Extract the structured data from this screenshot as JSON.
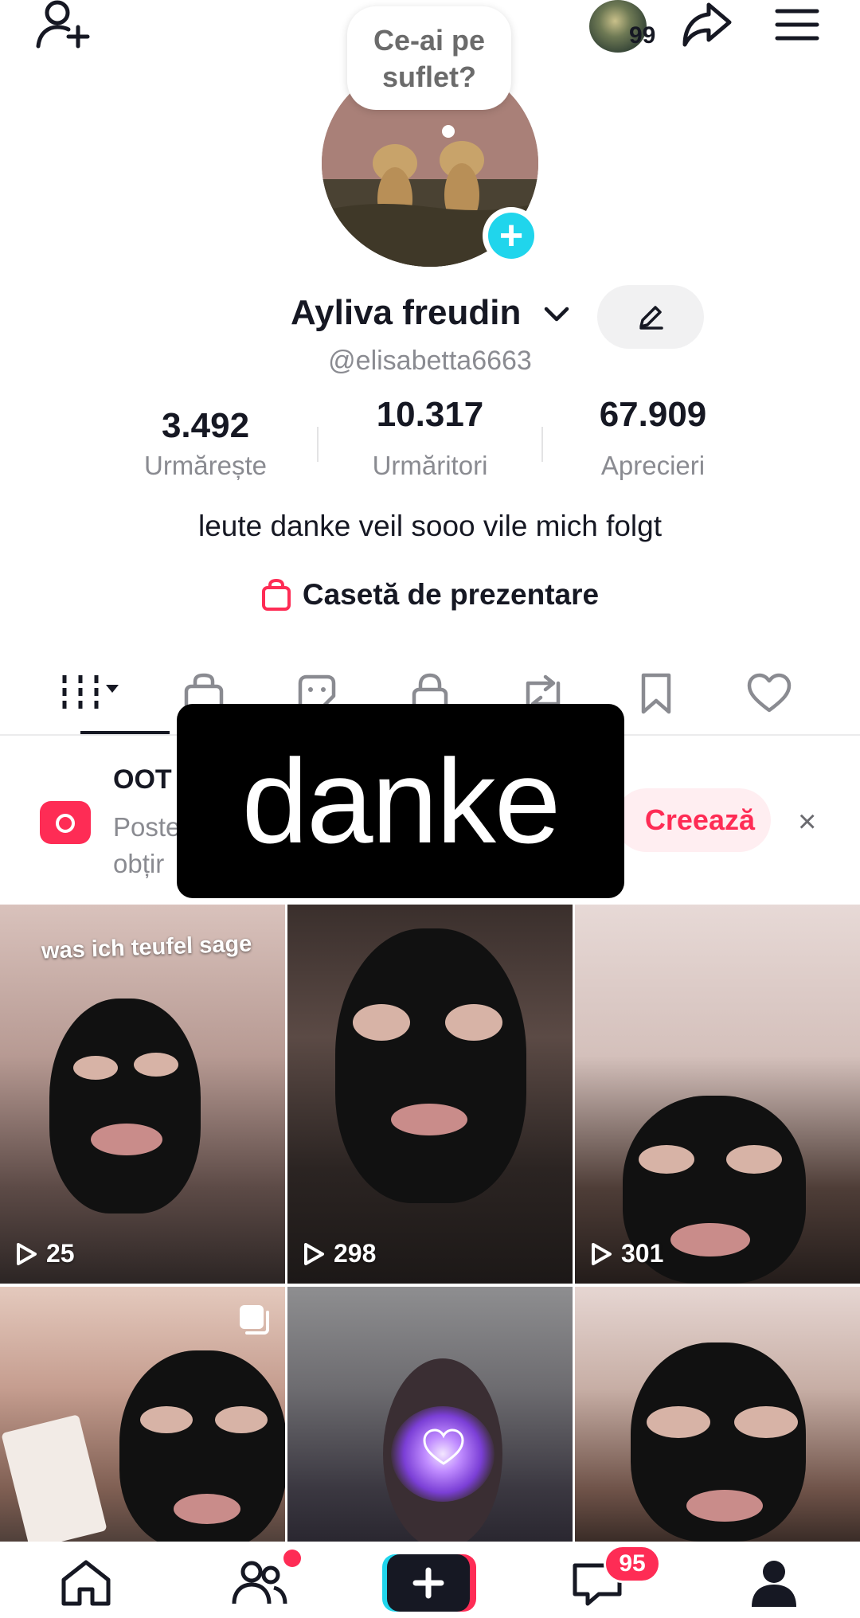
{
  "header": {
    "add_friend_icon": "person-plus-icon",
    "story_count": "99",
    "share_icon": "share-arrow-icon",
    "menu_icon": "hamburger-icon"
  },
  "profile": {
    "bubble_text": "Ce-ai pe suflet?",
    "name": "Ayliva freudin",
    "handle": "@elisabetta6663",
    "stats": [
      {
        "value": "3.492",
        "label": "Urmărește"
      },
      {
        "value": "10.317",
        "label": "Urmăritori"
      },
      {
        "value": "67.909",
        "label": "Aprecieri"
      }
    ],
    "bio": "leute danke veil sooo  vile mich folgt",
    "showcase_label": "Casetă de prezentare"
  },
  "tabs": [
    {
      "icon": "grid-icon",
      "active": true
    },
    {
      "icon": "shopping-bag-icon"
    },
    {
      "icon": "sticker-icon"
    },
    {
      "icon": "lock-icon"
    },
    {
      "icon": "repost-icon"
    },
    {
      "icon": "bookmark-icon"
    },
    {
      "icon": "heart-icon"
    }
  ],
  "banner": {
    "title": "OOT",
    "subtitle_1": "Poste",
    "subtitle_2": "obțir",
    "create_label": "Creează",
    "close": "×"
  },
  "overlay": {
    "text": "danke"
  },
  "videos": [
    {
      "views": "25",
      "caption": "was ich teufel sage"
    },
    {
      "views": "298"
    },
    {
      "views": "301"
    },
    {
      "views": ""
    },
    {
      "views": ""
    },
    {
      "views": ""
    }
  ],
  "bottom_nav": {
    "messages_badge": "95"
  },
  "colors": {
    "accent": "#fe2c55",
    "cyan": "#20d5ec",
    "text": "#161823",
    "muted": "#8a8b91"
  }
}
